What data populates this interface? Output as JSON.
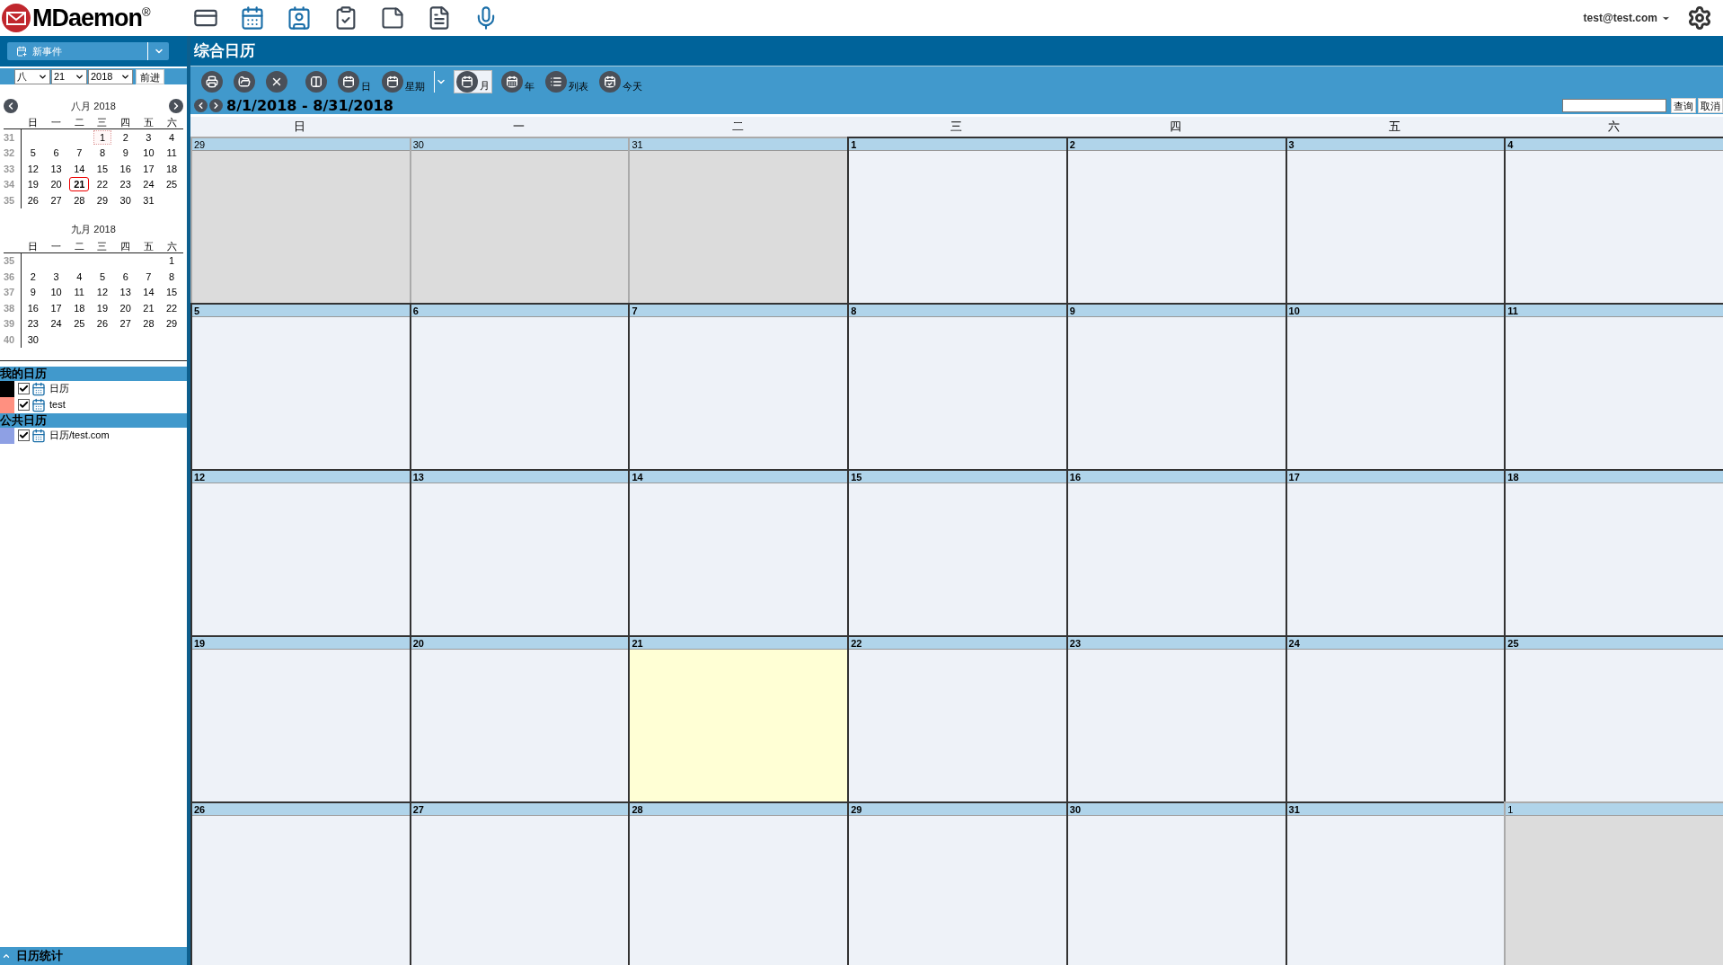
{
  "header": {
    "logo": "MDaemon",
    "logo_mark": "®",
    "user": "test@test.com"
  },
  "sidebar": {
    "new_event": "新事件",
    "date_picker": {
      "month": "八",
      "day": "21",
      "year": "2018",
      "go": "前进"
    },
    "mini_calendars": [
      {
        "title": "八月 2018",
        "weekdays": [
          "日",
          "一",
          "二",
          "三",
          "四",
          "五",
          "六"
        ],
        "weeks": [
          {
            "week": "31",
            "right_aligned": true,
            "days": [
              {
                "n": "1",
                "today": false,
                "focused": true
              },
              {
                "n": "2",
                "today": false,
                "focused": false
              },
              {
                "n": "3",
                "today": false,
                "focused": false
              },
              {
                "n": "4",
                "today": false,
                "focused": false
              }
            ]
          },
          {
            "week": "32",
            "days": [
              {
                "n": "5",
                "today": false,
                "focused": false
              },
              {
                "n": "6",
                "today": false,
                "focused": false
              },
              {
                "n": "7",
                "today": false,
                "focused": false
              },
              {
                "n": "8",
                "today": false,
                "focused": false
              },
              {
                "n": "9",
                "today": false,
                "focused": false
              },
              {
                "n": "10",
                "today": false,
                "focused": false
              },
              {
                "n": "11",
                "today": false,
                "focused": false
              }
            ]
          },
          {
            "week": "33",
            "days": [
              {
                "n": "12",
                "today": false,
                "focused": false
              },
              {
                "n": "13",
                "today": false,
                "focused": false
              },
              {
                "n": "14",
                "today": false,
                "focused": false
              },
              {
                "n": "15",
                "today": false,
                "focused": false
              },
              {
                "n": "16",
                "today": false,
                "focused": false
              },
              {
                "n": "17",
                "today": false,
                "focused": false
              },
              {
                "n": "18",
                "today": false,
                "focused": false
              }
            ]
          },
          {
            "week": "34",
            "days": [
              {
                "n": "19",
                "today": false,
                "focused": false
              },
              {
                "n": "20",
                "today": false,
                "focused": false
              },
              {
                "n": "21",
                "today": true,
                "focused": false
              },
              {
                "n": "22",
                "today": false,
                "focused": false
              },
              {
                "n": "23",
                "today": false,
                "focused": false
              },
              {
                "n": "24",
                "today": false,
                "focused": false
              },
              {
                "n": "25",
                "today": false,
                "focused": false
              }
            ]
          },
          {
            "week": "35",
            "right_aligned": false,
            "days": [
              {
                "n": "26",
                "today": false,
                "focused": false
              },
              {
                "n": "27",
                "today": false,
                "focused": false
              },
              {
                "n": "28",
                "today": false,
                "focused": false
              },
              {
                "n": "29",
                "today": false,
                "focused": false
              },
              {
                "n": "30",
                "today": false,
                "focused": false
              },
              {
                "n": "31",
                "today": false,
                "focused": false
              }
            ]
          }
        ]
      },
      {
        "title": "九月 2018",
        "weekdays": [
          "日",
          "一",
          "二",
          "三",
          "四",
          "五",
          "六"
        ],
        "weeks": [
          {
            "week": "35",
            "right_aligned": true,
            "days": [
              {
                "n": "1",
                "today": false,
                "focused": false
              }
            ]
          },
          {
            "week": "36",
            "days": [
              {
                "n": "2",
                "today": false,
                "focused": false
              },
              {
                "n": "3",
                "today": false,
                "focused": false
              },
              {
                "n": "4",
                "today": false,
                "focused": false
              },
              {
                "n": "5",
                "today": false,
                "focused": false
              },
              {
                "n": "6",
                "today": false,
                "focused": false
              },
              {
                "n": "7",
                "today": false,
                "focused": false
              },
              {
                "n": "8",
                "today": false,
                "focused": false
              }
            ]
          },
          {
            "week": "37",
            "days": [
              {
                "n": "9",
                "today": false,
                "focused": false
              },
              {
                "n": "10",
                "today": false,
                "focused": false
              },
              {
                "n": "11",
                "today": false,
                "focused": false
              },
              {
                "n": "12",
                "today": false,
                "focused": false
              },
              {
                "n": "13",
                "today": false,
                "focused": false
              },
              {
                "n": "14",
                "today": false,
                "focused": false
              },
              {
                "n": "15",
                "today": false,
                "focused": false
              }
            ]
          },
          {
            "week": "38",
            "days": [
              {
                "n": "16",
                "today": false,
                "focused": false
              },
              {
                "n": "17",
                "today": false,
                "focused": false
              },
              {
                "n": "18",
                "today": false,
                "focused": false
              },
              {
                "n": "19",
                "today": false,
                "focused": false
              },
              {
                "n": "20",
                "today": false,
                "focused": false
              },
              {
                "n": "21",
                "today": false,
                "focused": false
              },
              {
                "n": "22",
                "today": false,
                "focused": false
              }
            ]
          },
          {
            "week": "39",
            "days": [
              {
                "n": "23",
                "today": false,
                "focused": false
              },
              {
                "n": "24",
                "today": false,
                "focused": false
              },
              {
                "n": "25",
                "today": false,
                "focused": false
              },
              {
                "n": "26",
                "today": false,
                "focused": false
              },
              {
                "n": "27",
                "today": false,
                "focused": false
              },
              {
                "n": "28",
                "today": false,
                "focused": false
              },
              {
                "n": "29",
                "today": false,
                "focused": false
              }
            ]
          },
          {
            "week": "40",
            "right_aligned": false,
            "days": [
              {
                "n": "30",
                "today": false,
                "focused": false
              }
            ]
          }
        ]
      }
    ],
    "calendar_groups": [
      {
        "title": "我的日历",
        "items": [
          {
            "name": "日历",
            "color": "#000000",
            "checked": true
          },
          {
            "name": "test",
            "color": "#ff9080",
            "checked": true
          }
        ]
      },
      {
        "title": "公共日历",
        "items": [
          {
            "name": "日历/test.com",
            "color": "#8ea0e4",
            "checked": true
          }
        ]
      }
    ],
    "footer": "日历统计"
  },
  "main": {
    "title": "综合日历",
    "toolbar": [
      {
        "kind": "print",
        "selected": false
      },
      {
        "kind": "open",
        "selected": false
      },
      {
        "kind": "delete",
        "selected": false
      },
      {
        "kind": "split",
        "selected": false
      },
      {
        "kind": "day",
        "label": "日",
        "selected": false
      },
      {
        "kind": "week",
        "label": "星期",
        "selected": false
      },
      {
        "kind": "dropdown",
        "selected": false
      },
      {
        "kind": "month",
        "label": "月",
        "selected": true
      },
      {
        "kind": "year",
        "label": "年",
        "selected": false
      },
      {
        "kind": "list",
        "label": "列表",
        "selected": false
      },
      {
        "kind": "today",
        "label": "今天",
        "selected": false
      }
    ],
    "range": "8/1/2018 - 8/31/2018",
    "search": {
      "query": "查询",
      "cancel": "取消"
    },
    "weekdays": [
      "日",
      "一",
      "二",
      "三",
      "四",
      "五",
      "六"
    ],
    "weeks": [
      [
        {
          "n": "29",
          "in_month": false,
          "today": false
        },
        {
          "n": "30",
          "in_month": false,
          "today": false
        },
        {
          "n": "31",
          "in_month": false,
          "today": false
        },
        {
          "n": "1",
          "in_month": true,
          "today": false
        },
        {
          "n": "2",
          "in_month": true,
          "today": false
        },
        {
          "n": "3",
          "in_month": true,
          "today": false
        },
        {
          "n": "4",
          "in_month": true,
          "today": false
        }
      ],
      [
        {
          "n": "5",
          "in_month": true,
          "today": false
        },
        {
          "n": "6",
          "in_month": true,
          "today": false
        },
        {
          "n": "7",
          "in_month": true,
          "today": false
        },
        {
          "n": "8",
          "in_month": true,
          "today": false
        },
        {
          "n": "9",
          "in_month": true,
          "today": false
        },
        {
          "n": "10",
          "in_month": true,
          "today": false
        },
        {
          "n": "11",
          "in_month": true,
          "today": false
        }
      ],
      [
        {
          "n": "12",
          "in_month": true,
          "today": false
        },
        {
          "n": "13",
          "in_month": true,
          "today": false
        },
        {
          "n": "14",
          "in_month": true,
          "today": false
        },
        {
          "n": "15",
          "in_month": true,
          "today": false
        },
        {
          "n": "16",
          "in_month": true,
          "today": false
        },
        {
          "n": "17",
          "in_month": true,
          "today": false
        },
        {
          "n": "18",
          "in_month": true,
          "today": false
        }
      ],
      [
        {
          "n": "19",
          "in_month": true,
          "today": false
        },
        {
          "n": "20",
          "in_month": true,
          "today": false
        },
        {
          "n": "21",
          "in_month": true,
          "today": true
        },
        {
          "n": "22",
          "in_month": true,
          "today": false
        },
        {
          "n": "23",
          "in_month": true,
          "today": false
        },
        {
          "n": "24",
          "in_month": true,
          "today": false
        },
        {
          "n": "25",
          "in_month": true,
          "today": false
        }
      ],
      [
        {
          "n": "26",
          "in_month": true,
          "today": false
        },
        {
          "n": "27",
          "in_month": true,
          "today": false
        },
        {
          "n": "28",
          "in_month": true,
          "today": false
        },
        {
          "n": "29",
          "in_month": true,
          "today": false
        },
        {
          "n": "30",
          "in_month": true,
          "today": false
        },
        {
          "n": "31",
          "in_month": true,
          "today": false
        },
        {
          "n": "1",
          "in_month": false,
          "today": false
        }
      ]
    ]
  }
}
